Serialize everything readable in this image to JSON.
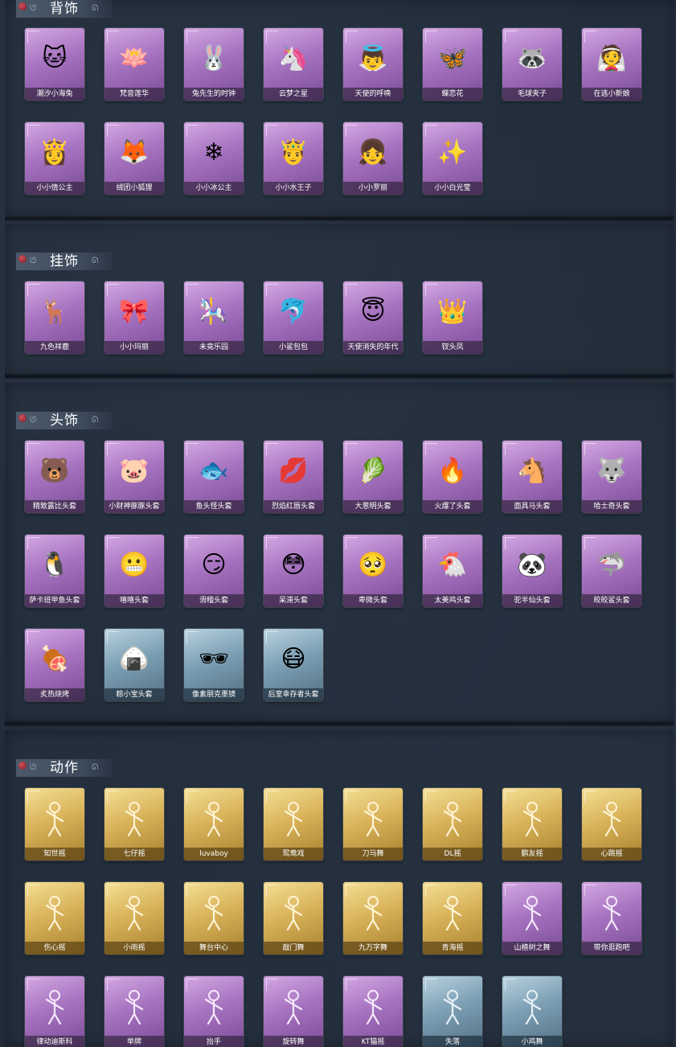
{
  "sections": [
    {
      "title": "背饰",
      "items": [
        {
          "label": "潮汐小海兔",
          "rarity": "purple",
          "icon": "blue-cat-icon"
        },
        {
          "label": "梵音莲华",
          "rarity": "purple",
          "icon": "lotus-doll-icon"
        },
        {
          "label": "兔先生的时钟",
          "rarity": "purple",
          "icon": "rabbit-clock-icon"
        },
        {
          "label": "云梦之星",
          "rarity": "purple",
          "icon": "unicorn-star-icon"
        },
        {
          "label": "天使的呼唤",
          "rarity": "purple",
          "icon": "angel-icon"
        },
        {
          "label": "蝶恋花",
          "rarity": "purple",
          "icon": "butterfly-flower-icon"
        },
        {
          "label": "毛球夹子",
          "rarity": "purple",
          "icon": "raccoon-clip-icon"
        },
        {
          "label": "在逃小新娘",
          "rarity": "purple",
          "icon": "red-bride-icon"
        },
        {
          "label": "小小情公主",
          "rarity": "purple",
          "icon": "pink-princess-icon"
        },
        {
          "label": "绒团小狐狸",
          "rarity": "purple",
          "icon": "fox-icon"
        },
        {
          "label": "小小冰公主",
          "rarity": "purple",
          "icon": "ice-princess-icon"
        },
        {
          "label": "小小水王子",
          "rarity": "purple",
          "icon": "water-prince-icon"
        },
        {
          "label": "小小罗丽",
          "rarity": "purple",
          "icon": "doll-girl-icon"
        },
        {
          "label": "小小白光莹",
          "rarity": "purple",
          "icon": "white-light-doll-icon"
        }
      ]
    },
    {
      "title": "挂饰",
      "items": [
        {
          "label": "九色祥鹿",
          "rarity": "purple",
          "icon": "deer-icon"
        },
        {
          "label": "小小玛丽",
          "rarity": "purple",
          "icon": "mary-doll-icon"
        },
        {
          "label": "未竟乐园",
          "rarity": "purple",
          "icon": "paradise-doll-icon"
        },
        {
          "label": "小鲨包包",
          "rarity": "purple",
          "icon": "shark-bag-icon"
        },
        {
          "label": "天使消失的年代",
          "rarity": "purple",
          "icon": "angel-doll-icon"
        },
        {
          "label": "钗头凤",
          "rarity": "purple",
          "icon": "phoenix-doll-icon"
        }
      ]
    },
    {
      "title": "头饰",
      "items": [
        {
          "label": "精致露比头套",
          "rarity": "purple",
          "icon": "pink-bear-mask-icon"
        },
        {
          "label": "小财神豚豚头套",
          "rarity": "purple",
          "icon": "pig-mask-icon"
        },
        {
          "label": "鱼头怪头套",
          "rarity": "purple",
          "icon": "fish-head-icon"
        },
        {
          "label": "烈焰红唇头套",
          "rarity": "purple",
          "icon": "red-lips-mask-icon"
        },
        {
          "label": "大葱明头套",
          "rarity": "purple",
          "icon": "scallion-mask-icon"
        },
        {
          "label": "火爆了头套",
          "rarity": "purple",
          "icon": "fire-mask-icon"
        },
        {
          "label": "面具马头套",
          "rarity": "purple",
          "icon": "horse-mask-icon"
        },
        {
          "label": "哈士奇头套",
          "rarity": "purple",
          "icon": "husky-mask-icon"
        },
        {
          "label": "萨卡班甲鱼头套",
          "rarity": "purple",
          "icon": "seal-fish-mask-icon"
        },
        {
          "label": "嘻嘻头套",
          "rarity": "purple",
          "icon": "grin-emoji-icon"
        },
        {
          "label": "滑稽头套",
          "rarity": "purple",
          "icon": "funny-emoji-icon"
        },
        {
          "label": "呆滞头套",
          "rarity": "purple",
          "icon": "dazed-emoji-icon"
        },
        {
          "label": "卑微头套",
          "rarity": "purple",
          "icon": "humble-emoji-icon"
        },
        {
          "label": "太美鸡头套",
          "rarity": "purple",
          "icon": "chicken-mask-icon"
        },
        {
          "label": "驼半仙头套",
          "rarity": "purple",
          "icon": "raccoon-mask-icon"
        },
        {
          "label": "皎皎鲨头套",
          "rarity": "purple",
          "icon": "shark-mask-icon"
        },
        {
          "label": "炙热烧烤",
          "rarity": "purple",
          "icon": "bbq-mask-icon"
        },
        {
          "label": "粽小宝头套",
          "rarity": "blue",
          "icon": "zongzi-mask-icon"
        },
        {
          "label": "像素朋克墨镜",
          "rarity": "blue",
          "icon": "pixel-sunglasses-icon"
        },
        {
          "label": "后室幸存者头套",
          "rarity": "blue",
          "icon": "gas-mask-icon"
        }
      ]
    },
    {
      "title": "动作",
      "items": [
        {
          "label": "知世摇",
          "rarity": "gold",
          "icon": "dance-pose-icon"
        },
        {
          "label": "七仔摇",
          "rarity": "gold",
          "icon": "dance-pose-icon"
        },
        {
          "label": "luvaboy",
          "rarity": "gold",
          "icon": "dance-pose-icon"
        },
        {
          "label": "鸳鸯戏",
          "rarity": "gold",
          "icon": "dance-pose-icon"
        },
        {
          "label": "刀马舞",
          "rarity": "gold",
          "icon": "dance-pose-icon"
        },
        {
          "label": "DL摇",
          "rarity": "gold",
          "icon": "dance-pose-icon"
        },
        {
          "label": "鹏友摇",
          "rarity": "gold",
          "icon": "dance-pose-icon"
        },
        {
          "label": "心跳摇",
          "rarity": "gold",
          "icon": "dance-pose-icon"
        },
        {
          "label": "伤心摇",
          "rarity": "gold",
          "icon": "dance-pose-icon"
        },
        {
          "label": "小雨摇",
          "rarity": "gold",
          "icon": "dance-pose-icon"
        },
        {
          "label": "舞台中心",
          "rarity": "gold",
          "icon": "dance-pose-icon"
        },
        {
          "label": "敲门舞",
          "rarity": "gold",
          "icon": "dance-pose-icon"
        },
        {
          "label": "九万字舞",
          "rarity": "gold",
          "icon": "dance-pose-icon"
        },
        {
          "label": "青海摇",
          "rarity": "gold",
          "icon": "dance-pose-icon"
        },
        {
          "label": "山楂树之舞",
          "rarity": "purple",
          "icon": "dance-pose-icon"
        },
        {
          "label": "带你逛跑吧",
          "rarity": "purple",
          "icon": "dance-pose-icon"
        },
        {
          "label": "律动迪斯科",
          "rarity": "purple",
          "icon": "dance-pose-icon"
        },
        {
          "label": "举牌",
          "rarity": "purple",
          "icon": "hold-sign-pose-icon"
        },
        {
          "label": "抬手",
          "rarity": "purple",
          "icon": "raise-hand-pose-icon"
        },
        {
          "label": "旋转舞",
          "rarity": "purple",
          "icon": "dance-pose-icon"
        },
        {
          "label": "KT猫摇",
          "rarity": "purple",
          "icon": "dance-pose-icon"
        },
        {
          "label": "失落",
          "rarity": "blue",
          "icon": "kneel-pose-icon"
        },
        {
          "label": "小鸡舞",
          "rarity": "blue",
          "icon": "dance-pose-icon"
        }
      ]
    }
  ]
}
